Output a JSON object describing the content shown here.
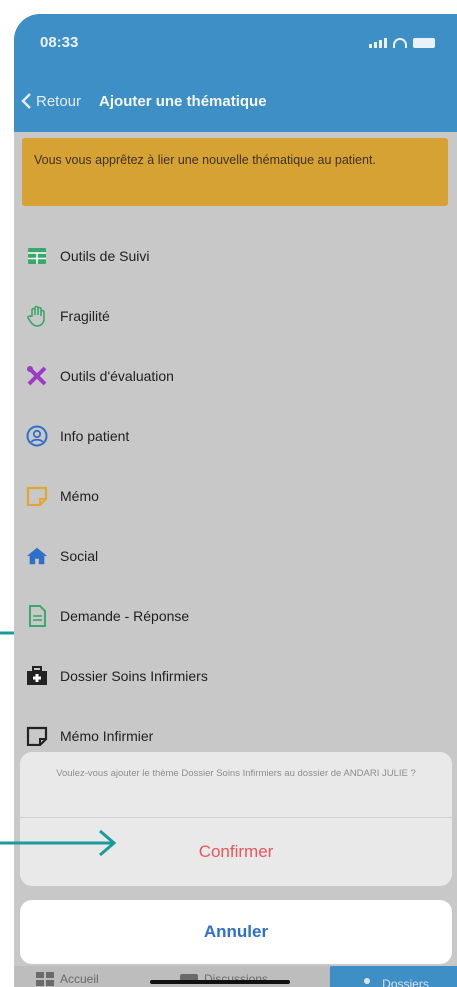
{
  "status": {
    "time": "08:33"
  },
  "nav": {
    "back_label": "Retour",
    "title": "Ajouter une thématique"
  },
  "banner": {
    "text": "Vous vous apprêtez à lier une nouvelle thématique au patient."
  },
  "items": [
    {
      "label": "Outils de Suivi",
      "icon": "table-icon",
      "color": "#3aa86b"
    },
    {
      "label": "Fragilité",
      "icon": "hand-icon",
      "color": "#3aa86b"
    },
    {
      "label": "Outils d'évaluation",
      "icon": "tools-icon",
      "color": "#9c3bc4"
    },
    {
      "label": "Info patient",
      "icon": "user-circle-icon",
      "color": "#2f6fc9"
    },
    {
      "label": "Mémo",
      "icon": "note-icon",
      "color": "#e3a72f"
    },
    {
      "label": "Social",
      "icon": "home-icon",
      "color": "#2f6fc9"
    },
    {
      "label": "Demande - Réponse",
      "icon": "document-icon",
      "color": "#3aa86b"
    },
    {
      "label": "Dossier Soins Infirmiers",
      "icon": "medical-bag-icon",
      "color": "#222222"
    },
    {
      "label": "Mémo Infirmier",
      "icon": "note-outline-icon",
      "color": "#222222"
    }
  ],
  "sheet": {
    "message": "Voulez-vous ajouter le thème Dossier Soins Infirmiers au dossier de ANDARI JULIE ?",
    "confirm_label": "Confirmer",
    "cancel_label": "Annuler"
  },
  "tabs": [
    {
      "label": "Accueil",
      "icon": "grid-icon"
    },
    {
      "label": "Discussions",
      "icon": "chat-icon"
    },
    {
      "label": "Dossiers",
      "icon": "folder-user-icon"
    }
  ],
  "colors": {
    "primary": "#3f8fc7",
    "banner": "#d6a233",
    "confirm": "#e6575a",
    "cancel": "#2f6fc9",
    "annotation_arrow": "#1a9a9a"
  }
}
